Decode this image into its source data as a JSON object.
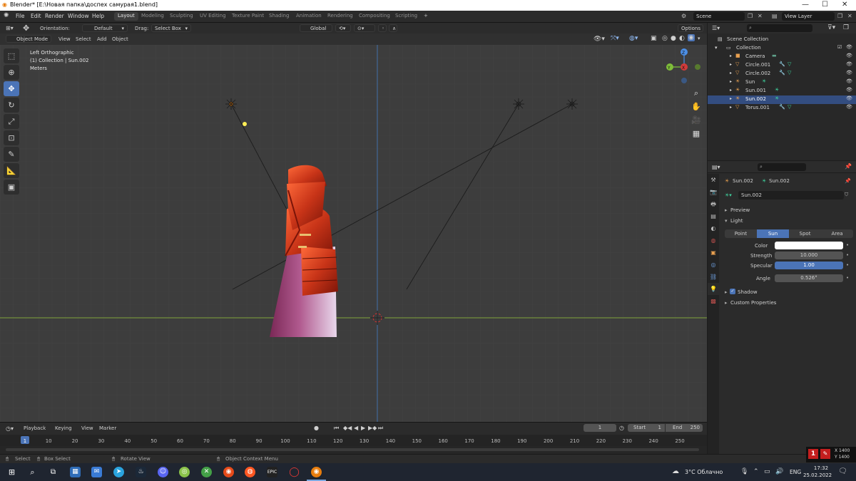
{
  "window": {
    "title": "Blender* [E:\\Новая папка\\доспех самурая1.blend]",
    "minimize": "—",
    "maximize": "☐",
    "close": "✕"
  },
  "menu": {
    "file": "File",
    "edit": "Edit",
    "render": "Render",
    "window": "Window",
    "help": "Help"
  },
  "workspaces": [
    "Layout",
    "Modeling",
    "Sculpting",
    "UV Editing",
    "Texture Paint",
    "Shading",
    "Animation",
    "Rendering",
    "Compositing",
    "Scripting"
  ],
  "add_workspace": "+",
  "scene": {
    "label": "Scene",
    "view_layer": "View Layer"
  },
  "tool_header": {
    "orientation_label": "Orientation:",
    "orientation_value": "Default",
    "drag_label": "Drag:",
    "drag_value": "Select Box",
    "transform_space": "Global",
    "options": "Options"
  },
  "viewport_header": {
    "mode": "Object Mode",
    "view": "View",
    "select": "Select",
    "add": "Add",
    "object": "Object"
  },
  "viewport_info": {
    "line1": "Left Orthographic",
    "line2": "(1) Collection | Sun.002",
    "line3": "Meters"
  },
  "gizmo": {
    "z": "Z",
    "y": "Y",
    "x": "X"
  },
  "outliner": {
    "scene_collection": "Scene Collection",
    "collection": "Collection",
    "items": [
      "Camera",
      "Circle.001",
      "Circle.002",
      "Sun",
      "Sun.001",
      "Sun.002",
      "Torus.001"
    ]
  },
  "properties": {
    "object_name": "Sun.002",
    "data_name": "Sun.002",
    "datablock": "Sun.002",
    "preview": "Preview",
    "light": "Light",
    "light_types": [
      "Point",
      "Sun",
      "Spot",
      "Area"
    ],
    "color_label": "Color",
    "strength_label": "Strength",
    "strength_value": "10.000",
    "specular_label": "Specular",
    "specular_value": "1.00",
    "angle_label": "Angle",
    "angle_value": "0.526°",
    "shadow": "Shadow",
    "custom_properties": "Custom Properties"
  },
  "timeline": {
    "playback": "Playback",
    "keying": "Keying",
    "view": "View",
    "marker": "Marker",
    "current_frame": "1",
    "start_label": "Start",
    "start_value": "1",
    "end_label": "End",
    "end_value": "250",
    "ticks": [
      "1",
      "10",
      "20",
      "30",
      "40",
      "50",
      "60",
      "70",
      "80",
      "90",
      "100",
      "110",
      "120",
      "130",
      "140",
      "150",
      "160",
      "170",
      "180",
      "190",
      "200",
      "210",
      "220",
      "230",
      "240",
      "250"
    ]
  },
  "statusbar": {
    "select": "Select",
    "box_select": "Box Select",
    "rotate_view": "Rotate View",
    "context_menu": "Object Context Menu"
  },
  "overlay_widget": {
    "x": "X 1400",
    "y": "Y 1400"
  },
  "taskbar": {
    "weather": "3°C  Облачно",
    "lang": "ENG",
    "time": "17:32",
    "date": "25.02.2022"
  },
  "colors": {
    "accent_blue": "#4b74b7",
    "axis_green": "#7fa33a",
    "axis_blue": "#3f6ea8",
    "armor_red": "#c83418",
    "skirt_pink": "#b15a8f"
  }
}
